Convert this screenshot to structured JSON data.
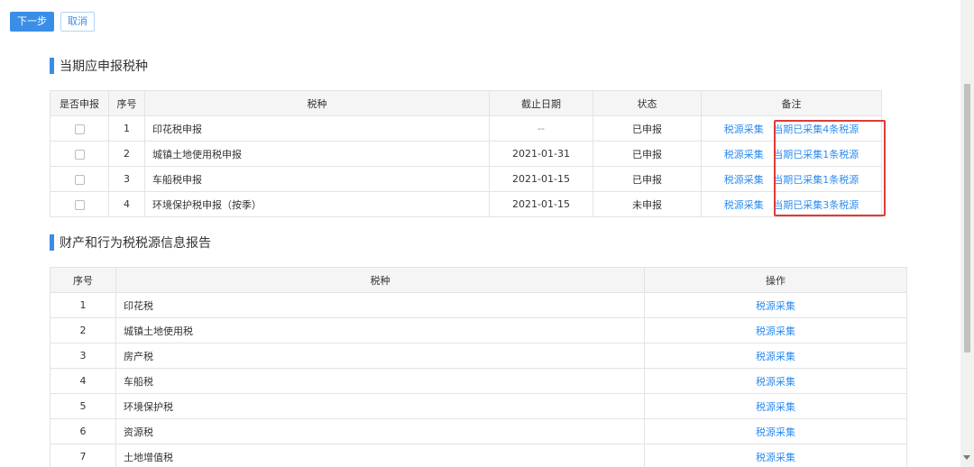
{
  "toolbar": {
    "next_label": "下一步",
    "cancel_label": "取消"
  },
  "section1": {
    "title": "当期应申报税种",
    "headers": [
      "是否申报",
      "序号",
      "税种",
      "截止日期",
      "状态",
      "备注"
    ],
    "rows": [
      {
        "no": "1",
        "tax": "印花税申报",
        "deadline": "--",
        "status": "已申报",
        "action": "税源采集",
        "note": "当期已采集4条税源"
      },
      {
        "no": "2",
        "tax": "城镇土地使用税申报",
        "deadline": "2021-01-31",
        "status": "已申报",
        "action": "税源采集",
        "note": "当期已采集1条税源"
      },
      {
        "no": "3",
        "tax": "车船税申报",
        "deadline": "2021-01-15",
        "status": "已申报",
        "action": "税源采集",
        "note": "当期已采集1条税源"
      },
      {
        "no": "4",
        "tax": "环境保护税申报（按季）",
        "deadline": "2021-01-15",
        "status": "未申报",
        "action": "税源采集",
        "note": "当期已采集3条税源"
      }
    ]
  },
  "section2": {
    "title": "财产和行为税税源信息报告",
    "headers": [
      "序号",
      "税种",
      "操作"
    ],
    "rows": [
      {
        "no": "1",
        "tax": "印花税",
        "action": "税源采集"
      },
      {
        "no": "2",
        "tax": "城镇土地使用税",
        "action": "税源采集"
      },
      {
        "no": "3",
        "tax": "房产税",
        "action": "税源采集"
      },
      {
        "no": "4",
        "tax": "车船税",
        "action": "税源采集"
      },
      {
        "no": "5",
        "tax": "环境保护税",
        "action": "税源采集"
      },
      {
        "no": "6",
        "tax": "资源税",
        "action": "税源采集"
      },
      {
        "no": "7",
        "tax": "土地增值税",
        "action": "税源采集"
      }
    ]
  },
  "colors": {
    "accent": "#3a8ee6",
    "link": "#2d8cf0",
    "highlight": "#e03a3a"
  }
}
